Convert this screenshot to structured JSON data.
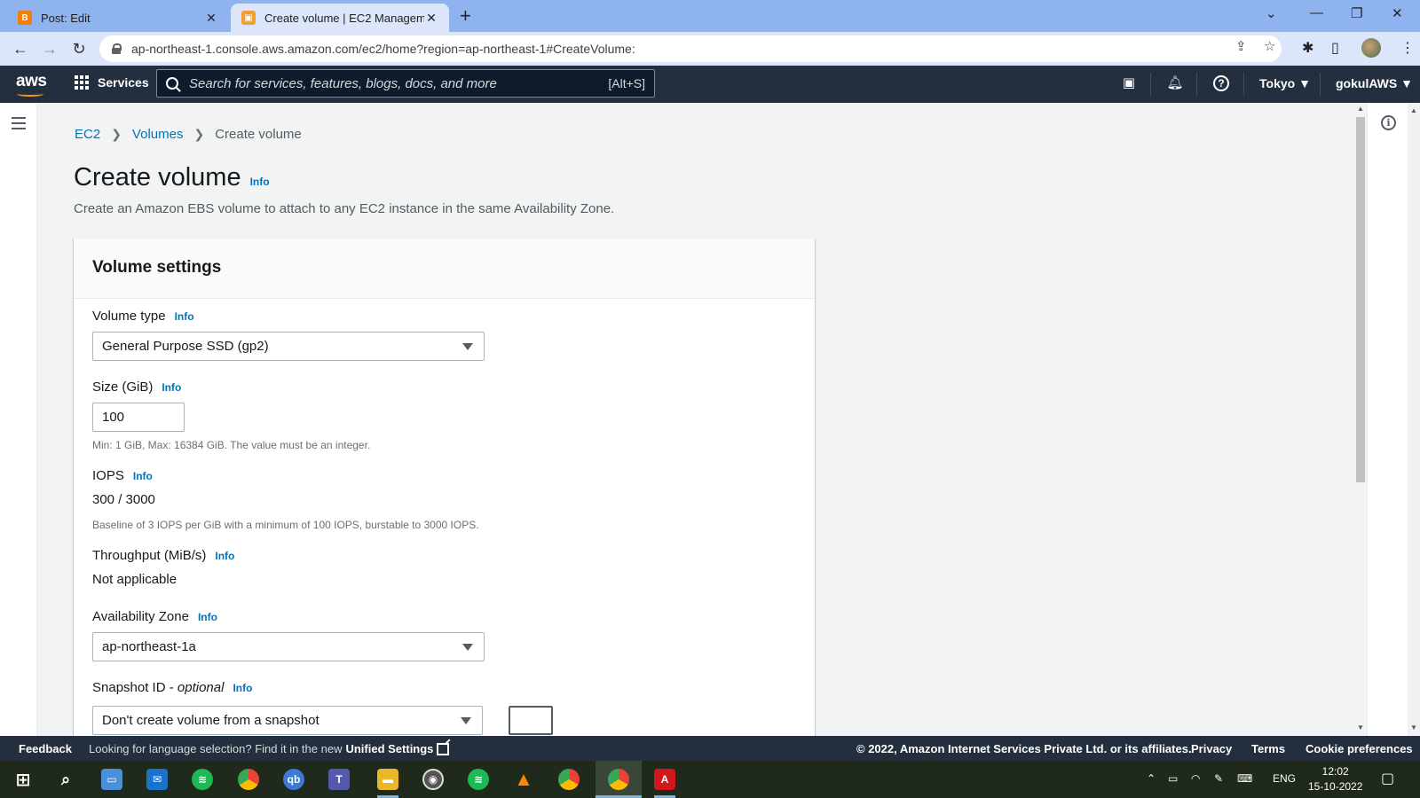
{
  "browser": {
    "tabs": [
      {
        "title": "Post: Edit",
        "active": false
      },
      {
        "title": "Create volume | EC2 Managemen",
        "active": true
      }
    ],
    "url": "ap-northeast-1.console.aws.amazon.com/ec2/home?region=ap-northeast-1#CreateVolume:"
  },
  "aws_nav": {
    "logo": "aws",
    "services_label": "Services",
    "search_placeholder": "Search for services, features, blogs, docs, and more",
    "search_shortcut": "[Alt+S]",
    "region": "Tokyo ▼",
    "user": "gokulAWS ▼"
  },
  "breadcrumb": {
    "items": [
      "EC2",
      "Volumes",
      "Create volume"
    ]
  },
  "page": {
    "title": "Create volume",
    "title_info": "Info",
    "description": "Create an Amazon EBS volume to attach to any EC2 instance in the same Availability Zone."
  },
  "panel": {
    "heading": "Volume settings",
    "info_label": "Info",
    "volume_type": {
      "label": "Volume type",
      "value": "General Purpose SSD (gp2)"
    },
    "size": {
      "label": "Size (GiB)",
      "value": "100",
      "hint": "Min: 1 GiB, Max: 16384 GiB. The value must be an integer."
    },
    "iops": {
      "label": "IOPS",
      "value": "300 / 3000",
      "hint": "Baseline of 3 IOPS per GiB with a minimum of 100 IOPS, burstable to 3000 IOPS."
    },
    "throughput": {
      "label": "Throughput (MiB/s)",
      "value": "Not applicable"
    },
    "availability_zone": {
      "label": "Availability Zone",
      "value": "ap-northeast-1a"
    },
    "snapshot": {
      "label": "Snapshot ID - ",
      "label_optional": "optional",
      "value": "Don't create volume from a snapshot"
    }
  },
  "footer": {
    "feedback": "Feedback",
    "lang_prompt": "Looking for language selection? Find it in the new",
    "lang_link": "Unified Settings",
    "copyright": "© 2022, Amazon Internet Services Private Ltd. or its affiliates.",
    "privacy": "Privacy",
    "terms": "Terms",
    "cookies": "Cookie preferences"
  },
  "taskbar": {
    "language": "ENG",
    "time": "12:02",
    "date": "15-10-2022"
  },
  "colors": {
    "aws_nav": "#232f3e",
    "link": "#0073bb",
    "aws_orange": "#ff9900",
    "tabbar": "#8fb3ee"
  }
}
